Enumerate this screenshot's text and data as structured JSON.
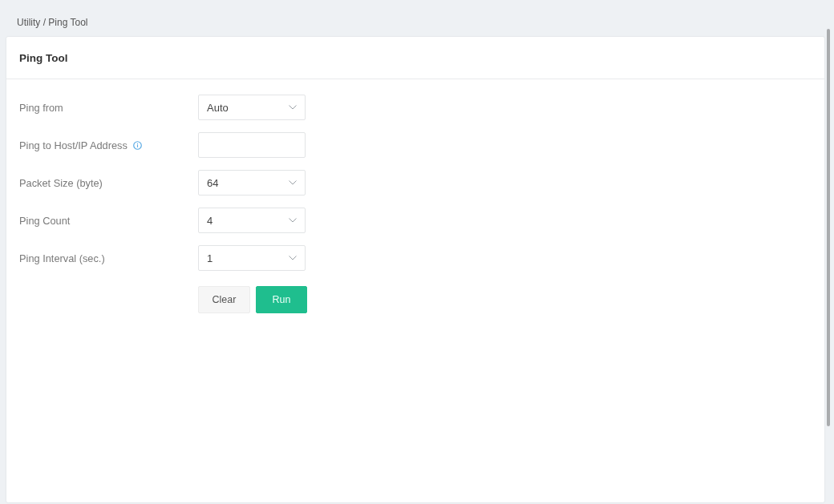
{
  "breadcrumb": "Utility / Ping Tool",
  "panel": {
    "title": "Ping Tool"
  },
  "fields": [
    {
      "label": "Ping from",
      "kind": "select",
      "value": "Auto",
      "info": false
    },
    {
      "label": "Ping to Host/IP Address",
      "kind": "text",
      "info": true
    },
    {
      "label": "Packet Size (byte)",
      "kind": "select",
      "value": "64",
      "info": false
    },
    {
      "label": "Ping Count",
      "kind": "select",
      "value": "4",
      "info": false
    },
    {
      "label": "Ping Interval (sec.)",
      "kind": "select",
      "value": "1",
      "info": false
    }
  ],
  "buttons": [
    {
      "label": "Clear",
      "kind": "secondary"
    },
    {
      "label": "Run",
      "kind": "primary"
    }
  ]
}
